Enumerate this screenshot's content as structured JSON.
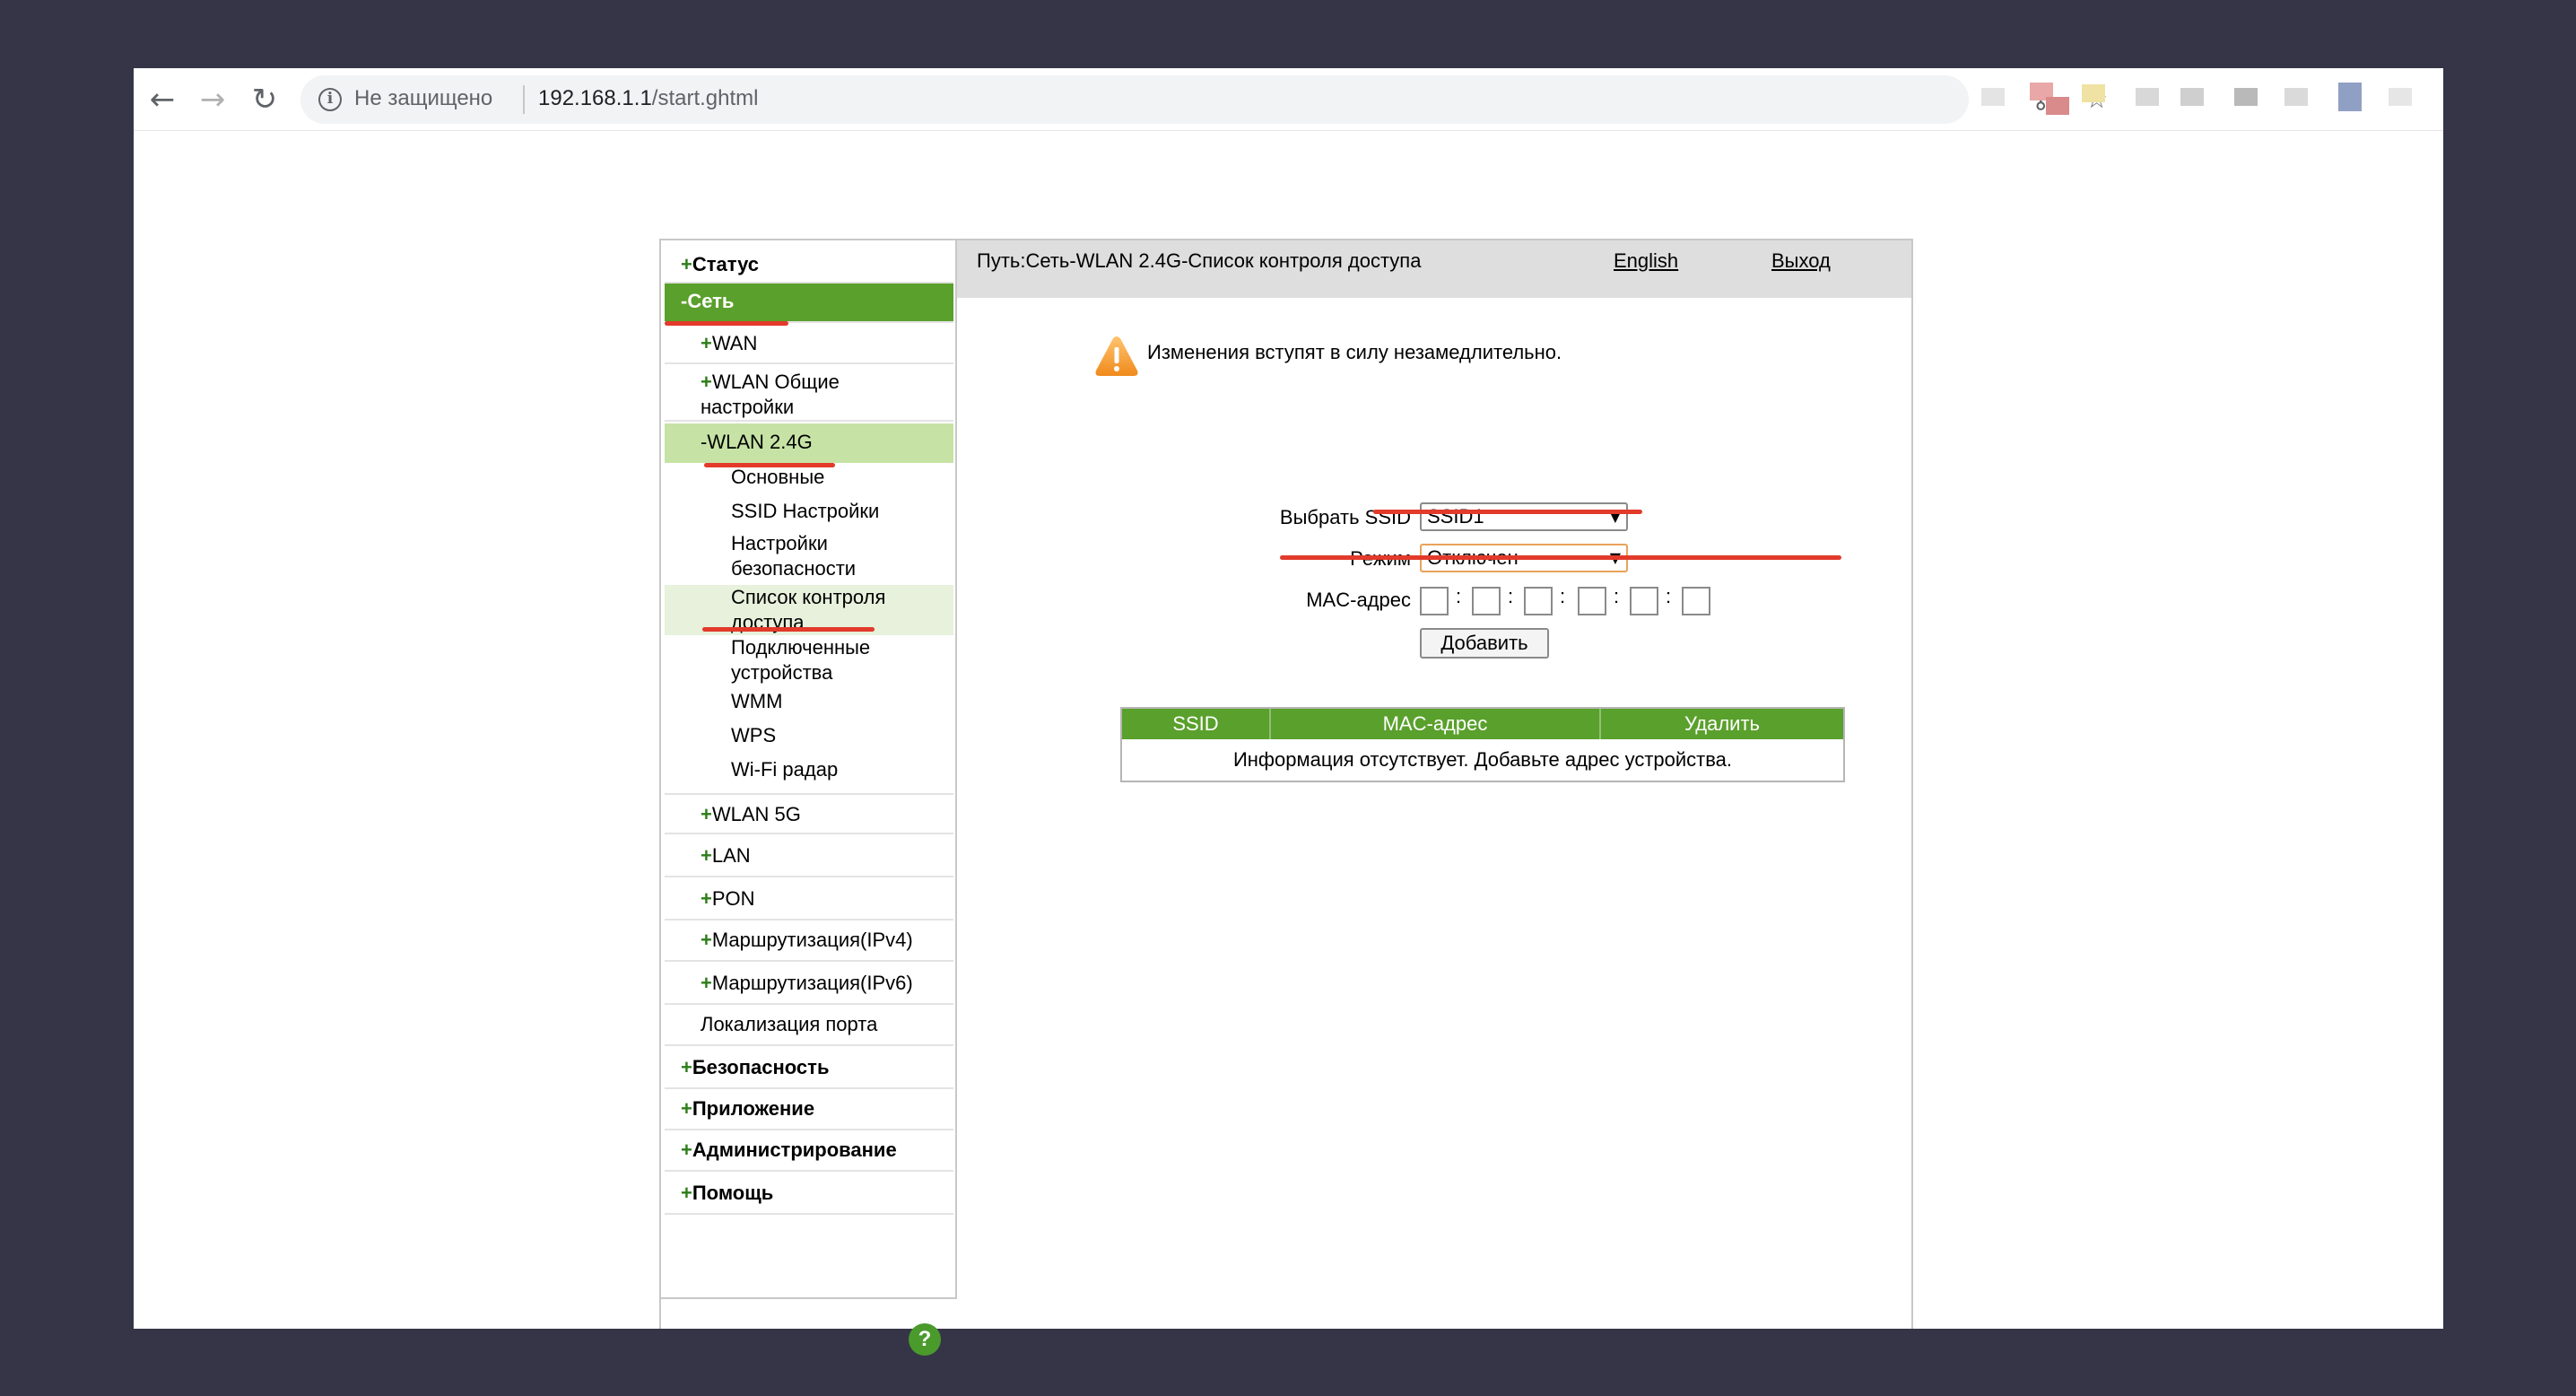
{
  "browser": {
    "security_label": "Не защищено",
    "url_host": "192.168.1.1",
    "url_path": "/start.ghtml"
  },
  "menu": {
    "status": {
      "sign": "+",
      "label": "Статус"
    },
    "network": {
      "sign": "-",
      "label": "Сеть"
    },
    "wan": {
      "sign": "+",
      "label": "WAN"
    },
    "wlan_general_line1": {
      "sign": "+",
      "label": "WLAN Общие"
    },
    "wlan_general_line2": "настройки",
    "wlan24": {
      "sign": "-",
      "label": "WLAN 2.4G"
    },
    "basic": "Основные",
    "ssid_settings": "SSID Настройки",
    "security_settings_line1": "Настройки",
    "security_settings_line2": "безопасности",
    "acl_line1": "Список контроля",
    "acl_line2": "доступа",
    "connected_line1": "Подключенные",
    "connected_line2": "устройства",
    "wmm": "WMM",
    "wps": "WPS",
    "wifi_radar": "Wi-Fi радар",
    "wlan5": {
      "sign": "+",
      "label": "WLAN 5G"
    },
    "lan": {
      "sign": "+",
      "label": "LAN"
    },
    "pon": {
      "sign": "+",
      "label": "PON"
    },
    "routing4": {
      "sign": "+",
      "label": "Маршрутизация(IPv4)"
    },
    "routing6": {
      "sign": "+",
      "label": "Маршрутизация(IPv6)"
    },
    "port_local": "Локализация порта",
    "security": {
      "sign": "+",
      "label": "Безопасность"
    },
    "application": {
      "sign": "+",
      "label": "Приложение"
    },
    "admin": {
      "sign": "+",
      "label": "Администрирование"
    },
    "help": {
      "sign": "+",
      "label": "Помощь"
    },
    "help_glyph": "?"
  },
  "header": {
    "path": "Путь:Сеть-WLAN 2.4G-Список контроля доступа",
    "language_link": "English",
    "exit_link": "Выход"
  },
  "notice": "Изменения вступят в силу незамедлительно.",
  "form": {
    "ssid_label": "Выбрать SSID",
    "ssid_value": "SSID1",
    "mode_label": "Режим",
    "mode_value": "Отключен",
    "mac_label": "MAC-адрес",
    "mac_separator": ":",
    "add_button": "Добавить"
  },
  "table": {
    "headers": [
      "SSID",
      "MAC-адрес",
      "Удалить"
    ],
    "empty_message": "Информация отсутствует. Добавьте адрес устройства."
  },
  "colors": {
    "accent_green": "#5aa02c",
    "highlight_red": "#e23a2b"
  }
}
